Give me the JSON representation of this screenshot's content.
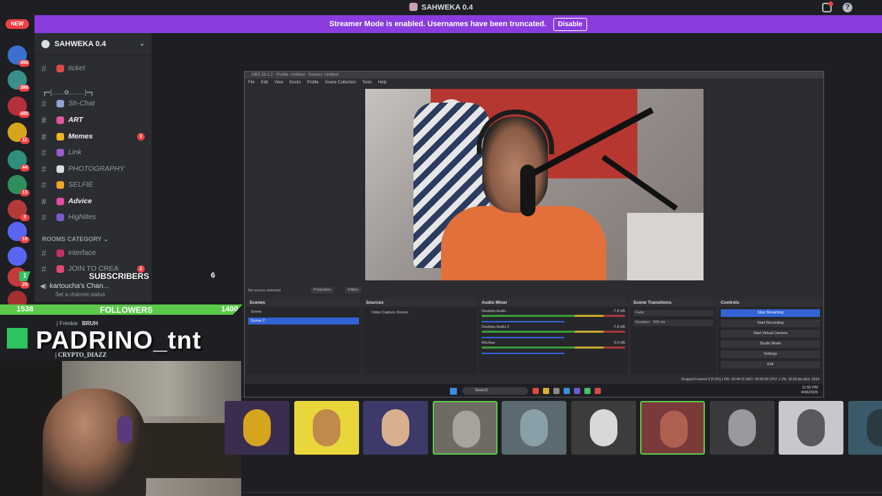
{
  "window": {
    "title": "SAHWEKA 0.4",
    "help": "?"
  },
  "banner": {
    "message": "Streamer Mode is enabled. Usernames have been truncated.",
    "button": "Disable"
  },
  "rail": {
    "new_label": "NEW",
    "servers": [
      {
        "badge": "456",
        "color": "#3b6fd1"
      },
      {
        "badge": "386",
        "color": "#3a8f88"
      },
      {
        "badge": "485",
        "color": "#b4303a"
      },
      {
        "badge": "11",
        "color": "#d6a51e"
      },
      {
        "badge": "44",
        "color": "#2f8f7c"
      },
      {
        "badge": "13",
        "color": "#2f8f5a"
      },
      {
        "badge": "3",
        "color": "#b43a3a"
      },
      {
        "badge": "19",
        "color": "#5865f2"
      },
      {
        "badge": "",
        "color": "#5865f2"
      },
      {
        "badge": "29",
        "color": "#c23a3a"
      },
      {
        "badge": "8",
        "color": "#a33030"
      }
    ]
  },
  "sidebar": {
    "server_name": "SAHWEKA 0.4",
    "divider": "┏━[.......✿.........]━┓",
    "channels": [
      {
        "name": "ticket",
        "emoji_color": "#e04848",
        "bold": false,
        "badge": ""
      },
      {
        "name": "Sh-Chat",
        "emoji_color": "#8fa3d6",
        "bold": false,
        "badge": ""
      },
      {
        "name": "ART",
        "emoji_color": "#e0589a",
        "bold": true,
        "badge": ""
      },
      {
        "name": "Memes",
        "emoji_color": "#f0b429",
        "bold": true,
        "badge": "3"
      },
      {
        "name": "Link",
        "emoji_color": "#9b59d0",
        "bold": false,
        "badge": ""
      },
      {
        "name": "PHOTOGRAPHY",
        "emoji_color": "#dbdee1",
        "bold": false,
        "badge": ""
      },
      {
        "name": "SELFIE",
        "emoji_color": "#f0a52a",
        "bold": false,
        "badge": ""
      },
      {
        "name": "Advice",
        "emoji_color": "#e04ca6",
        "bold": true,
        "badge": ""
      },
      {
        "name": "Highlites",
        "emoji_color": "#7a5ad0",
        "bold": false,
        "badge": ""
      }
    ],
    "category": "ROOMS CATEGORY",
    "rooms": [
      {
        "name": "interface",
        "emoji_color": "#c2306a",
        "badge": ""
      },
      {
        "name": "JOIN TO CREA",
        "emoji_color": "#e04870",
        "badge": "2"
      }
    ],
    "voice": {
      "name": "kartoucha's Chan...",
      "status": "Set a channel status"
    }
  },
  "overlay": {
    "sub_count": "1",
    "subscribers_label": "SUBSCRIBERS",
    "sub_goal": "6",
    "followers_count": "1538",
    "followers_label": "FOLLOWERS",
    "followers_goal": "1400",
    "frankie": "| Frenkie",
    "bruh": "BRUH",
    "streamer_name": "PADRINO_tnt",
    "crypto": "| CRYPTO_DIAZZ"
  },
  "obs": {
    "title": "OBS 28.1.2 - Profile: Untitled - Scenes: Untitled",
    "menu": [
      "File",
      "Edit",
      "View",
      "Docks",
      "Profile",
      "Scene Collection",
      "Tools",
      "Help"
    ],
    "no_source": "No source selected",
    "properties": "Properties",
    "filters": "Filters",
    "docks": {
      "scenes": {
        "title": "Scenes",
        "items": [
          "Scene",
          "Scene 2"
        ],
        "selected": 1
      },
      "sources": {
        "title": "Sources",
        "items": [
          "Video Capture Device"
        ]
      },
      "mixer": {
        "title": "Audio Mixer",
        "rows": [
          {
            "name": "Desktop Audio",
            "db": "-7.8 dB"
          },
          {
            "name": "Desktop Audio 2",
            "db": "-7.8 dB"
          },
          {
            "name": "Mic/Aux",
            "db": "0.0 dB"
          }
        ]
      },
      "transitions": {
        "title": "Scene Transitions",
        "type": "Fade",
        "duration_label": "Duration",
        "duration": "300 ms"
      },
      "controls": {
        "title": "Controls",
        "buttons": [
          "Stop Streaming",
          "Start Recording",
          "Start Virtual Camera",
          "Studio Mode",
          "Settings",
          "Exit"
        ]
      }
    },
    "status": "Dropped Frames 0 (0.0%)   LIVE: 00:44:31   REC: 00:00:00   CPU: 1.3%, 30.00 fps   kb/s: 2634",
    "taskbar": {
      "search": "Search",
      "time": "11:55 PM",
      "date": "4/08/2025",
      "lang": "FRA"
    }
  },
  "avatars": [
    {
      "bg": "#3a2d50",
      "face": "#d6a51e",
      "active": false
    },
    {
      "bg": "#e8d63a",
      "face": "#c08a4a",
      "active": false
    },
    {
      "bg": "#3d3a6a",
      "face": "#d8b090",
      "active": false
    },
    {
      "bg": "#6f6a62",
      "face": "#a7a39a",
      "active": true
    },
    {
      "bg": "#5a6a70",
      "face": "#8aa0a8",
      "active": false
    },
    {
      "bg": "#3c3c3c",
      "face": "#d8d8d8",
      "active": false
    },
    {
      "bg": "#7a3a3a",
      "face": "#b06050",
      "active": true
    },
    {
      "bg": "#3a3a3c",
      "face": "#9a9a9e",
      "active": false
    },
    {
      "bg": "#c8c8cc",
      "face": "#5a5a5e",
      "active": false
    },
    {
      "bg": "#3a5a6a",
      "face": "#2a3a40",
      "active": false
    }
  ]
}
